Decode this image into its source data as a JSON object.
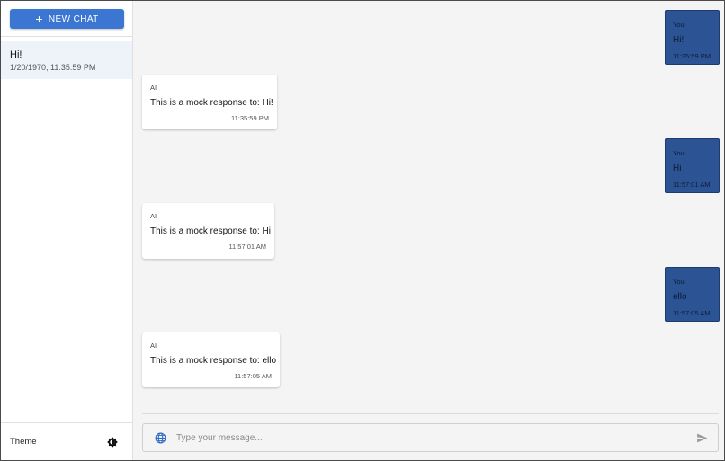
{
  "sidebar": {
    "new_chat_label": "NEW CHAT",
    "chats": [
      {
        "title": "Hi!",
        "date": "1/20/1970, 11:35:59 PM"
      }
    ],
    "theme_label": "Theme"
  },
  "messages": [
    {
      "sender": "You",
      "text": "Hi!",
      "time": "11:35:59 PM"
    },
    {
      "sender": "AI",
      "text": "This is a mock response to: Hi!",
      "time": "11:35:59 PM"
    },
    {
      "sender": "You",
      "text": "Hi",
      "time": "11:57:01 AM"
    },
    {
      "sender": "AI",
      "text": "This is a mock response to: Hi",
      "time": "11:57:01 AM"
    },
    {
      "sender": "You",
      "text": "ello",
      "time": "11:57:05 AM"
    },
    {
      "sender": "AI",
      "text": "This is a mock response to: ello",
      "time": "11:57:05 AM"
    }
  ],
  "composer": {
    "placeholder": "Type your message...",
    "value": ""
  },
  "icons": {
    "new_chat": "plus-icon",
    "theme": "brightness-icon",
    "web": "globe-icon",
    "send": "send-icon"
  },
  "colors": {
    "accent": "#3a76d2",
    "user_bubble": "#2c5494",
    "selected_chat": "#eef3fa",
    "main_background": "#f4f4f4"
  }
}
